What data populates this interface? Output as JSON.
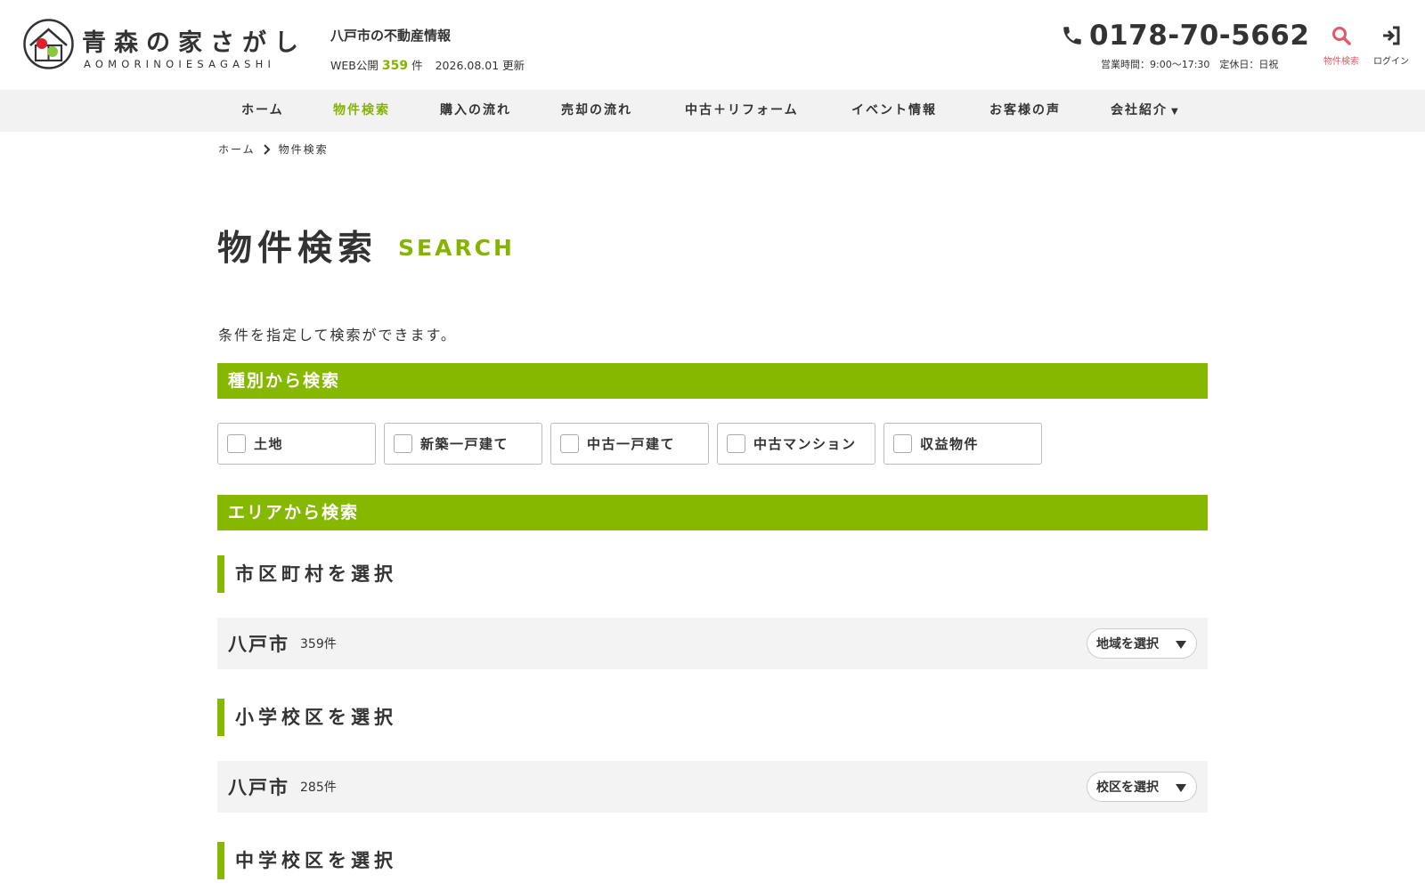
{
  "header": {
    "logo_title": "青森の家さがし",
    "logo_sub": "AOMORINOIESAGASHI",
    "tagline": "八戸市の不動産情報",
    "web_prefix": "WEB公開",
    "web_count": "359",
    "web_unit": "件",
    "update_text": "2026.08.01 更新",
    "phone": "0178-70-5662",
    "hours": "営業時間：9:00〜17:30　定休日：日祝",
    "search_label": "物件検索",
    "login_label": "ログイン"
  },
  "nav": {
    "items": [
      {
        "label": "ホーム"
      },
      {
        "label": "物件検索"
      },
      {
        "label": "購入の流れ"
      },
      {
        "label": "売却の流れ"
      },
      {
        "label": "中古＋リフォーム"
      },
      {
        "label": "イベント情報"
      },
      {
        "label": "お客様の声"
      },
      {
        "label": "会社紹介"
      }
    ],
    "caret": "▼"
  },
  "breadcrumb": {
    "home": "ホーム",
    "current": "物件検索"
  },
  "page": {
    "title": "物件検索",
    "title_en": "SEARCH",
    "intro": "条件を指定して検索ができます。"
  },
  "type_section": {
    "heading": "種別から検索",
    "options": [
      {
        "label": "土地"
      },
      {
        "label": "新築一戸建て"
      },
      {
        "label": "中古一戸建て"
      },
      {
        "label": "中古マンション"
      },
      {
        "label": "収益物件"
      }
    ]
  },
  "area_section": {
    "heading": "エリアから検索",
    "city": {
      "heading": "市区町村を選択",
      "name": "八戸市",
      "count": "359件",
      "button": "地域を選択"
    },
    "elementary": {
      "heading": "小学校区を選択",
      "name": "八戸市",
      "count": "285件",
      "button": "校区を選択"
    },
    "junior_high": {
      "heading": "中学校区を選択"
    }
  },
  "colors": {
    "accent": "#86b800",
    "search_icon": "#e05a6a",
    "text": "#333333",
    "row_bg": "#f3f3f3"
  }
}
